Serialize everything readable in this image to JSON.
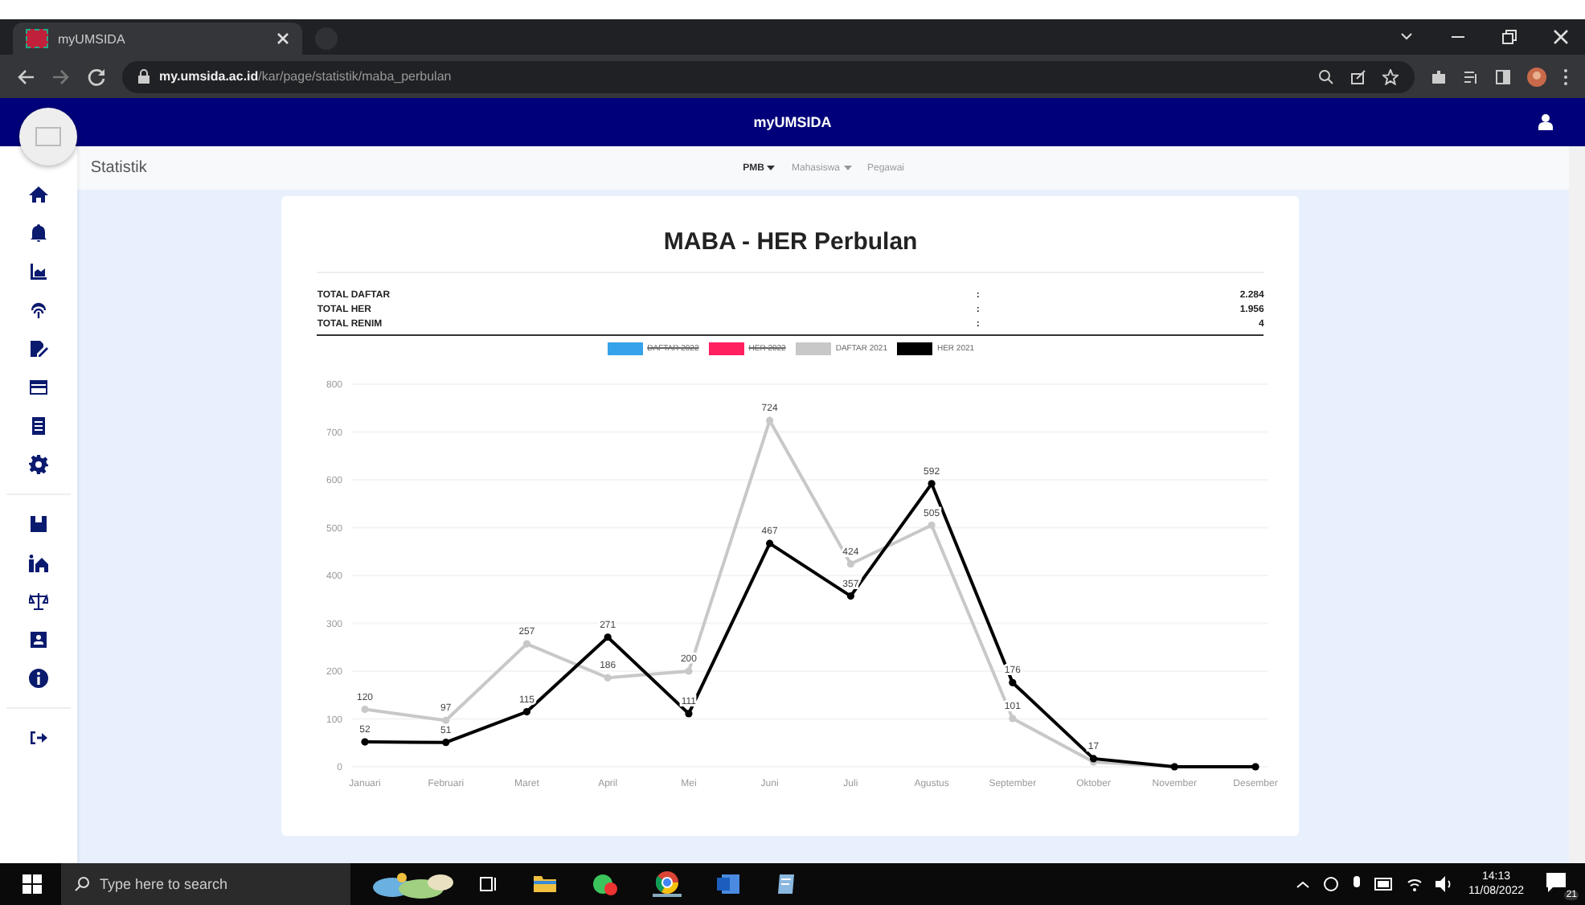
{
  "browser": {
    "tab_title": "myUMSIDA",
    "url_domain": "my.umsida.ac.id",
    "url_path": "/kar/page/statistik/maba_perbulan"
  },
  "header": {
    "title": "myUMSIDA"
  },
  "subbar": {
    "title": "Statistik",
    "menu": [
      {
        "label": "PMB",
        "dropdown": true,
        "selected": true
      },
      {
        "label": "Mahasiswa",
        "dropdown": true,
        "selected": false
      },
      {
        "label": "Pegawai",
        "dropdown": false,
        "selected": false
      }
    ]
  },
  "card": {
    "title": "MABA - HER Perbulan",
    "stats": [
      {
        "label": "TOTAL DAFTAR",
        "sep": ":",
        "value": "2.284"
      },
      {
        "label": "TOTAL HER",
        "sep": ":",
        "value": "1.956"
      },
      {
        "label": "TOTAL RENIM",
        "sep": ":",
        "value": "4"
      }
    ],
    "chart_data": {
      "type": "line",
      "categories": [
        "Januari",
        "Februari",
        "Maret",
        "April",
        "Mei",
        "Juni",
        "Juli",
        "Agustus",
        "September",
        "Oktober",
        "November",
        "Desember"
      ],
      "ylim": [
        0,
        800
      ],
      "yticks": [
        0,
        100,
        200,
        300,
        400,
        500,
        600,
        700,
        800
      ],
      "data_labels": true,
      "grid": true,
      "series": [
        {
          "name": "DAFTAR 2021",
          "color": "#c8c8c8",
          "marker": "circle",
          "values": [
            120,
            97,
            257,
            186,
            200,
            724,
            424,
            505,
            101,
            10,
            0,
            0
          ],
          "value_labels": [
            "120",
            "97",
            "257",
            "186",
            "200",
            "724",
            "424",
            "505",
            "101",
            null,
            null,
            null
          ]
        },
        {
          "name": "HER 2021",
          "color": "#000000",
          "marker": "circle",
          "values": [
            52,
            51,
            115,
            271,
            111,
            467,
            357,
            592,
            176,
            17,
            0,
            0
          ],
          "value_labels": [
            "52",
            "51",
            "115",
            "271",
            "111",
            "467",
            "357",
            "592",
            "176",
            "17",
            null,
            null
          ]
        }
      ]
    },
    "legend_extra": [
      {
        "label": "DAFTAR 2022",
        "color": "#36a2eb",
        "struck": true
      },
      {
        "label": "HER 2022",
        "color": "#ff2060",
        "struck": true
      }
    ]
  },
  "taskbar": {
    "search_placeholder": "Type here to search",
    "time": "14:13",
    "date": "11/08/2022",
    "notification_count": "21"
  }
}
